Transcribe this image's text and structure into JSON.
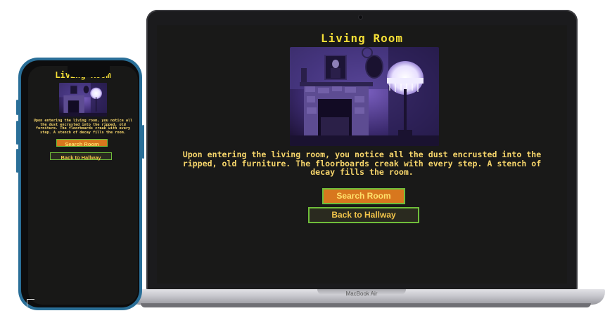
{
  "page": {
    "title": "Living Room",
    "description": "Upon entering the living room, you notice all the dust encrusted into the ripped, old furniture. The floorboards creak with every step. A stench of decay fills the room.",
    "buttons": {
      "search": "Search Room",
      "back": "Back to Hallway"
    }
  },
  "laptop": {
    "brand_label": "MacBook Air"
  },
  "colors": {
    "title": "#f5df37",
    "text": "#f6d56b",
    "button_fill": "#d8771e",
    "button_border": "#6fbe3a",
    "page_background": "#191918",
    "phone_frame": "#2a6f98"
  },
  "image": {
    "subject": "living-room-photo"
  }
}
